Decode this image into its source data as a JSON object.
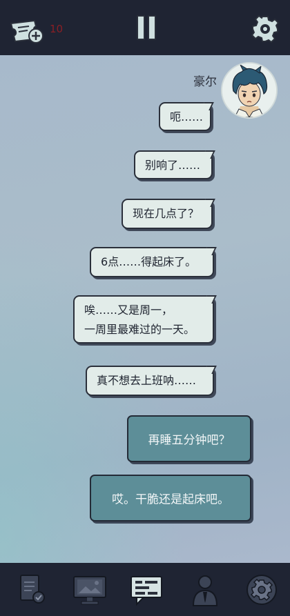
{
  "topbar": {
    "ticket_count": "10"
  },
  "chat": {
    "speaker": "豪尔",
    "messages": [
      "呃……",
      "别响了……",
      "现在几点了？",
      "6点……得起床了。",
      "唉……又是周一，",
      "一周里最难过的一天。",
      "真不想去上班呐……"
    ],
    "choices": [
      "再睡五分钟吧？",
      "哎。干脆还是起床吧。"
    ]
  },
  "icons": {
    "ticket": "ticket-plus-icon",
    "pause": "pause-icon",
    "settings": "gear-icon",
    "nav": [
      "document-check-icon",
      "monitor-image-icon",
      "chat-icon",
      "person-icon",
      "gear-badge-icon"
    ]
  },
  "colors": {
    "bar_bg": "#1f2433",
    "bubble_bg": "#e2ece9",
    "choice_bg": "#5d8e98",
    "counter_red": "#8a1f25"
  }
}
